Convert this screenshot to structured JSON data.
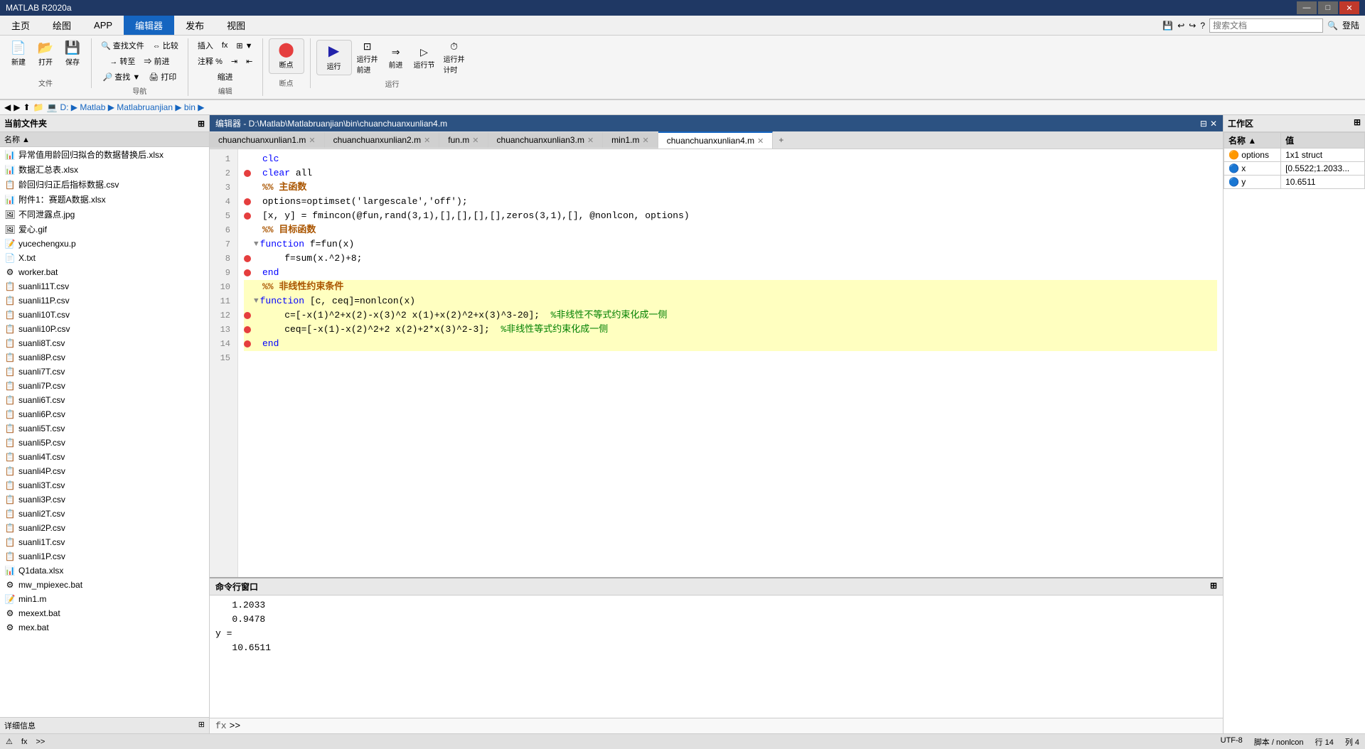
{
  "titlebar": {
    "title": "MATLAB R2020a",
    "min": "—",
    "max": "□",
    "close": "✕"
  },
  "menubar": {
    "tabs": [
      "主页",
      "绘图",
      "APP",
      "编辑器",
      "发布",
      "视图"
    ]
  },
  "toolbar": {
    "file_group": {
      "label": "文件",
      "buttons": [
        {
          "label": "新建",
          "icon": "📄"
        },
        {
          "label": "打开",
          "icon": "📂"
        },
        {
          "label": "保存",
          "icon": "💾"
        }
      ]
    },
    "nav_group": {
      "label": "导航",
      "buttons": [
        {
          "label": "查找文件",
          "icon": "🔍"
        },
        {
          "label": "比较",
          "icon": "⇔"
        },
        {
          "label": "转至",
          "icon": "→"
        },
        {
          "label": "查找 ▼",
          "icon": "🔎"
        },
        {
          "label": "打印",
          "icon": "🖨"
        }
      ]
    },
    "edit_group": {
      "label": "编辑",
      "buttons": [
        {
          "label": "插入",
          "icon": ""
        },
        {
          "label": "fx",
          "icon": ""
        },
        {
          "label": "注释",
          "icon": ""
        },
        {
          "label": "缩进",
          "icon": ""
        }
      ]
    },
    "breakpoint_group": {
      "label": "断点",
      "buttons": [
        {
          "label": "断点",
          "icon": "⬤"
        }
      ]
    },
    "run_group": {
      "label": "运行",
      "buttons": [
        {
          "label": "运行",
          "icon": "▶"
        },
        {
          "label": "运行并\n前进",
          "icon": "▶▶"
        },
        {
          "label": "前进",
          "icon": "→"
        },
        {
          "label": "运行节",
          "icon": "▶"
        },
        {
          "label": "运行并\n计时",
          "icon": "⏱"
        }
      ]
    },
    "search_placeholder": "搜索文档"
  },
  "addressbar": {
    "path": "D: ▶ Matlab ▶ Matlabruanjian ▶ bin ▶",
    "segments": [
      "D:",
      "Matlab",
      "Matlabruanjian",
      "bin"
    ]
  },
  "sidebar": {
    "header": "当前文件夹",
    "files": [
      {
        "name": "异常值用龄回归拟合的数据替换后.xlsx",
        "type": "excel"
      },
      {
        "name": "数据汇总表.xlsx",
        "type": "excel"
      },
      {
        "name": "龄回归归正后指标数据.csv",
        "type": "csv"
      },
      {
        "name": "附件1：赛题A数据.xlsx",
        "type": "excel"
      },
      {
        "name": "不同泄露点.jpg",
        "type": "image"
      },
      {
        "name": "爱心.gif",
        "type": "image"
      },
      {
        "name": "yucechengxu.p",
        "type": "code"
      },
      {
        "name": "X.txt",
        "type": "text"
      },
      {
        "name": "worker.bat",
        "type": "bat"
      },
      {
        "name": "suanli11T.csv",
        "type": "csv"
      },
      {
        "name": "suanli11P.csv",
        "type": "csv"
      },
      {
        "name": "suanli10T.csv",
        "type": "csv"
      },
      {
        "name": "suanli10P.csv",
        "type": "csv"
      },
      {
        "name": "suanli8T.csv",
        "type": "csv"
      },
      {
        "name": "suanli8P.csv",
        "type": "csv"
      },
      {
        "name": "suanli7T.csv",
        "type": "csv"
      },
      {
        "name": "suanli7P.csv",
        "type": "csv"
      },
      {
        "name": "suanli6T.csv",
        "type": "csv"
      },
      {
        "name": "suanli6P.csv",
        "type": "csv"
      },
      {
        "name": "suanli5T.csv",
        "type": "csv"
      },
      {
        "name": "suanli5P.csv",
        "type": "csv"
      },
      {
        "name": "suanli4T.csv",
        "type": "csv"
      },
      {
        "name": "suanli4P.csv",
        "type": "csv"
      },
      {
        "name": "suanli3T.csv",
        "type": "csv"
      },
      {
        "name": "suanli3P.csv",
        "type": "csv"
      },
      {
        "name": "suanli2T.csv",
        "type": "csv"
      },
      {
        "name": "suanli2P.csv",
        "type": "csv"
      },
      {
        "name": "suanli1T.csv",
        "type": "csv"
      },
      {
        "name": "suanli1P.csv",
        "type": "csv"
      },
      {
        "name": "Q1data.xlsx",
        "type": "excel"
      },
      {
        "name": "mw_mpiexec.bat",
        "type": "bat"
      },
      {
        "name": "min1.m",
        "type": "matlab"
      },
      {
        "name": "mexext.bat",
        "type": "bat"
      },
      {
        "name": "mex.bat",
        "type": "bat"
      }
    ],
    "detail_label": "详细信息"
  },
  "editor": {
    "titlebar": "编辑器 - D:\\Matlab\\Matlabruanjian\\bin\\chuanchuanxunlian4.m",
    "tabs": [
      {
        "label": "chuanchuanxunlian1.m",
        "active": false
      },
      {
        "label": "chuanchuanxunlian2.m",
        "active": false
      },
      {
        "label": "fun.m",
        "active": false
      },
      {
        "label": "chuanchuanxunlian3.m",
        "active": false
      },
      {
        "label": "min1.m",
        "active": false
      },
      {
        "label": "chuanchuanxunlian4.m",
        "active": true
      }
    ],
    "code": [
      {
        "ln": "1",
        "bp": false,
        "text": "clc",
        "type": "normal"
      },
      {
        "ln": "2",
        "bp": true,
        "text": "clear all",
        "type": "normal"
      },
      {
        "ln": "3",
        "bp": false,
        "text": "%% 主函数",
        "type": "section"
      },
      {
        "ln": "4",
        "bp": true,
        "text": "options=optimset('largescale','off');",
        "type": "normal"
      },
      {
        "ln": "5",
        "bp": true,
        "text": "[x, y] = fmincon(@fun,rand(3,1),[],[],[],[],zeros(3,1),[], @nonlcon, options)",
        "type": "normal"
      },
      {
        "ln": "6",
        "bp": false,
        "text": "%% 目标函数",
        "type": "section"
      },
      {
        "ln": "7",
        "bp": false,
        "text": "function f=fun(x)",
        "type": "function",
        "fold": true
      },
      {
        "ln": "8",
        "bp": true,
        "text": "    f=sum(x.^2)+8;",
        "type": "normal"
      },
      {
        "ln": "9",
        "bp": true,
        "text": "end",
        "type": "normal"
      },
      {
        "ln": "10",
        "bp": false,
        "text": "%% 非线性约束条件",
        "type": "section",
        "highlight": true
      },
      {
        "ln": "11",
        "bp": false,
        "text": "function [c, ceq]=nonlcon(x)",
        "type": "function",
        "fold": true,
        "highlight": true
      },
      {
        "ln": "12",
        "bp": true,
        "text": "    c=[-x(1)^2+x(2)-x(3)^2 x(1)+x(2)^2+x(3)^3-20];  %非线性不等式约束化成一侧",
        "type": "normal",
        "highlight": true
      },
      {
        "ln": "13",
        "bp": true,
        "text": "    ceq=[-x(1)-x(2)^2+2 x(2)+2*x(3)^2-3];  %非线性等式约束化成一侧",
        "type": "normal",
        "highlight": true
      },
      {
        "ln": "14",
        "bp": true,
        "text": "end",
        "type": "normal",
        "highlight": true
      },
      {
        "ln": "15",
        "bp": false,
        "text": "",
        "type": "normal",
        "highlight": true
      }
    ]
  },
  "command_window": {
    "title": "命令行窗口",
    "content": [
      "   1.2033",
      "   0.9478",
      "",
      "y =",
      "",
      "   10.6511"
    ],
    "prompt": "fx >>"
  },
  "workspace": {
    "title": "工作区",
    "columns": [
      "名称 ▲",
      "值"
    ],
    "variables": [
      {
        "name": "options",
        "value": "1x1 struct",
        "type": "struct"
      },
      {
        "name": "x",
        "value": "[0.5522;1.2033...",
        "type": "array"
      },
      {
        "name": "y",
        "value": "10.6511",
        "type": "scalar"
      }
    ]
  },
  "statusbar": {
    "encoding": "UTF-8",
    "script_type": "脚本 / nonlcon",
    "row": "行 14",
    "col": "列 4",
    "warning_icon": "⚠",
    "fx_prefix": "fx"
  }
}
